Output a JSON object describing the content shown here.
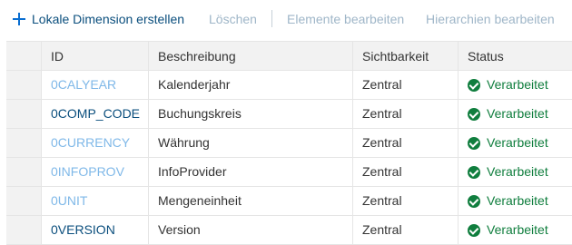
{
  "toolbar": {
    "create_label": "Lokale Dimension erstellen",
    "delete_label": "Löschen",
    "edit_elements_label": "Elemente bearbeiten",
    "edit_hierarchies_label": "Hierarchien bearbeiten"
  },
  "table": {
    "columns": {
      "id": "ID",
      "description": "Beschreibung",
      "visibility": "Sichtbarkeit",
      "status": "Status"
    },
    "rows": [
      {
        "id": "0CALYEAR",
        "description": "Kalenderjahr",
        "visibility": "Zentral",
        "status": "Verarbeitet",
        "id_style": "light"
      },
      {
        "id": "0COMP_CODE",
        "description": "Buchungskreis",
        "visibility": "Zentral",
        "status": "Verarbeitet",
        "id_style": "dark"
      },
      {
        "id": "0CURRENCY",
        "description": "Währung",
        "visibility": "Zentral",
        "status": "Verarbeitet",
        "id_style": "light"
      },
      {
        "id": "0INFOPROV",
        "description": "InfoProvider",
        "visibility": "Zentral",
        "status": "Verarbeitet",
        "id_style": "light"
      },
      {
        "id": "0UNIT",
        "description": "Mengeneinheit",
        "visibility": "Zentral",
        "status": "Verarbeitet",
        "id_style": "light"
      },
      {
        "id": "0VERSION",
        "description": "Version",
        "visibility": "Zentral",
        "status": "Verarbeitet",
        "id_style": "dark"
      }
    ]
  },
  "icons": {
    "create": "plus-icon",
    "status": "check-circle-icon"
  },
  "colors": {
    "accent": "#0a6ed1",
    "link_light": "#7fb8e8",
    "link_dark": "#0a4e7d",
    "disabled": "#9fb6c8",
    "success": "#107e3e"
  }
}
